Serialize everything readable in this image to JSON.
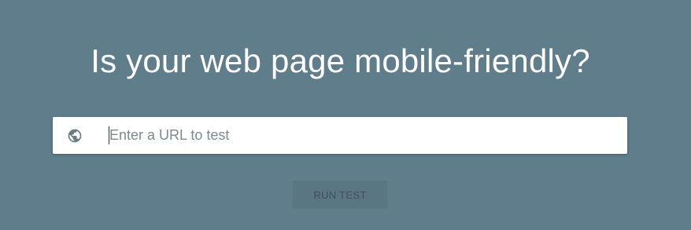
{
  "hero": {
    "headline": "Is your web page mobile-friendly?"
  },
  "url_field": {
    "icon": "globe-icon",
    "placeholder": "Enter a URL to test",
    "value": ""
  },
  "run_button": {
    "label": "RUN TEST",
    "enabled": false
  },
  "colors": {
    "background": "#607d8b",
    "headline": "#ffffff",
    "input_background": "#ffffff",
    "placeholder": "#7d8a92",
    "button_background": "#5b7683",
    "button_text": "#3d525c",
    "icon": "#6b7b83"
  }
}
